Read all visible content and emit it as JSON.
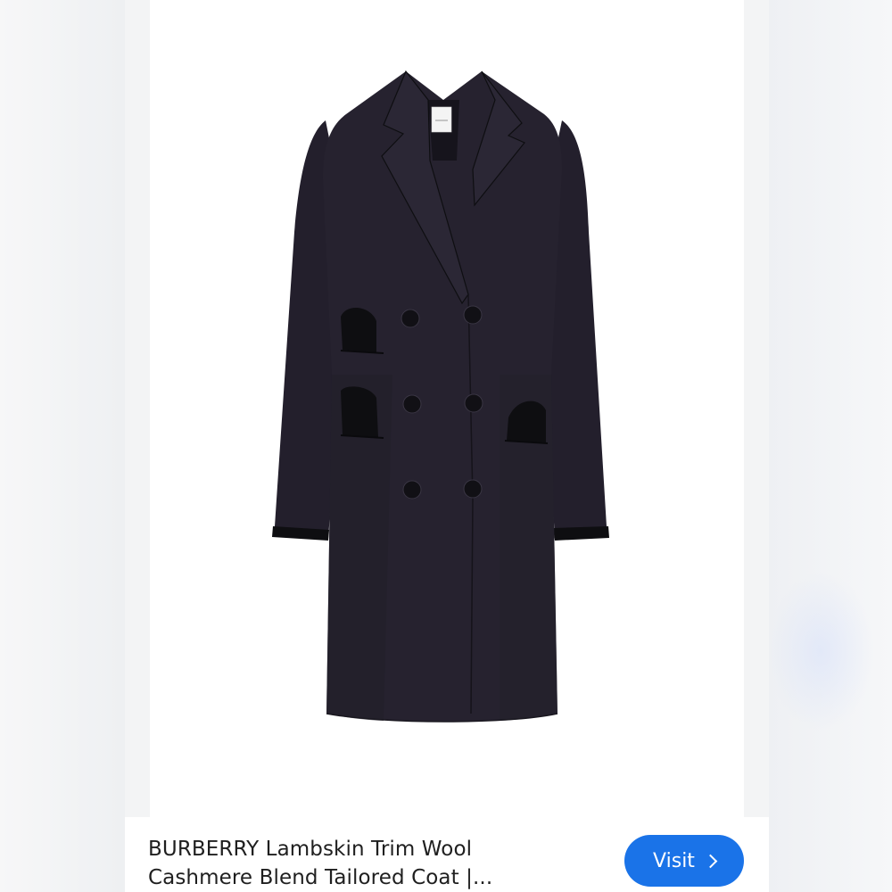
{
  "product": {
    "title_line1": "BURBERRY Lambskin Trim Wool",
    "title_line2": "Cashmere Blend Tailored Coat |...",
    "image_alt": "Navy double-breasted wool cashmere tailored coat with black lambskin trim"
  },
  "actions": {
    "visit_label": "Visit",
    "visit_icon": "chevron-right-icon"
  },
  "colors": {
    "accent": "#1a73e8",
    "coat": "#24212f",
    "trim": "#0f0f12"
  }
}
